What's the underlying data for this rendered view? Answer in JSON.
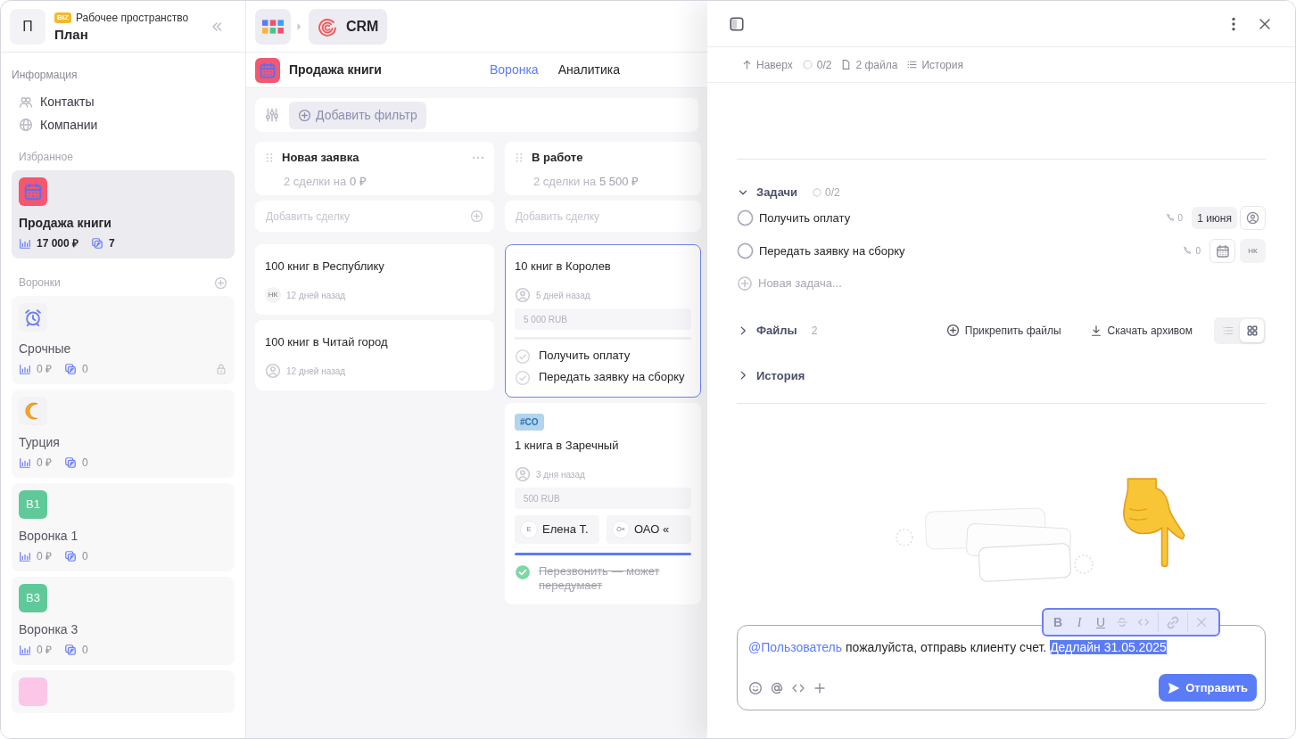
{
  "sidebar": {
    "workspace_avatar": "П",
    "badge": "BIZ",
    "workspace_label": "Рабочее пространство",
    "workspace_name": "План",
    "info_heading": "Информация",
    "info_items": [
      {
        "label": "Контакты"
      },
      {
        "label": "Компании"
      }
    ],
    "favorites_heading": "Избранное",
    "favorites": [
      {
        "kind": "calendar",
        "color": "#f4576f",
        "label": "Продажа книги",
        "amount": "17 000 ₽",
        "deals": "7",
        "selected": true,
        "locked": false
      }
    ],
    "funnels_heading": "Воронки",
    "funnels": [
      {
        "kind": "alarm",
        "label": "Срочные",
        "amount": "0 ₽",
        "deals": "0",
        "selected": false,
        "locked": true
      },
      {
        "kind": "moon",
        "label": "Турция",
        "amount": "0 ₽",
        "deals": "0",
        "selected": false,
        "locked": false
      },
      {
        "kind": "initials",
        "initials": "В1",
        "color": "#5fc99a",
        "label": "Воронка 1",
        "amount": "0 ₽",
        "deals": "0",
        "selected": false,
        "locked": false
      },
      {
        "kind": "initials",
        "initials": "В3",
        "color": "#5fc99a",
        "label": "Воронка 3",
        "amount": "0 ₽",
        "deals": "0",
        "selected": false,
        "locked": false
      },
      {
        "kind": "initials",
        "color": "#fcc6e8",
        "selected": false
      }
    ]
  },
  "breadcrumb": {
    "app": "CRM"
  },
  "page": {
    "title": "Продажа книги",
    "tabs": [
      {
        "label": "Воронка",
        "selected": true
      },
      {
        "label": "Аналитика",
        "selected": false
      }
    ]
  },
  "filter": {
    "button": "Добавить фильтр"
  },
  "columns": [
    {
      "title": "Новая заявка",
      "summary": "2 сделки на **0 ₽**",
      "add_placeholder": "Добавить сделку",
      "cards": [
        {
          "title": "100 книг в Республику",
          "selected": false,
          "avatar": "НК",
          "time": "12 дней назад"
        },
        {
          "title": "100 книг в Читай город",
          "selected": false,
          "time": "12 дней назад"
        }
      ]
    },
    {
      "title": "В работе",
      "summary": "2 сделки на **5 500 ₽**",
      "add_placeholder": "Добавить сделку",
      "cards": [
        {
          "title": "10 книг в Королев",
          "selected": true,
          "time": "5 дней назад",
          "amount": "5 000 RUB",
          "tasks": [
            {
              "label": "Получить оплату",
              "done": false
            },
            {
              "label": "Передать заявку на сборку",
              "done": false
            }
          ]
        },
        {
          "tag": "#CO",
          "title": "1 книга в Заречный",
          "selected": false,
          "time": "3 дня назад",
          "amount": "500 RUB",
          "contacts": [
            {
              "initial": "Е",
              "name": "Елена Т."
            },
            {
              "initial": "О«",
              "name": "ОАО «"
            }
          ],
          "tasks": [
            {
              "label": "Перезвонить — может передумает",
              "done": true
            }
          ]
        }
      ]
    }
  ],
  "detail": {
    "nav": [
      {
        "label": "Наверх"
      },
      {
        "label": "0/2"
      },
      {
        "label": "2 файла"
      },
      {
        "label": "История"
      }
    ],
    "tasks_section": {
      "title": "Задачи",
      "progress": "0/2",
      "expanded": true,
      "items": [
        {
          "label": "Получить оплату",
          "done": false,
          "calls": "0",
          "date": "1 июня"
        },
        {
          "label": "Передать заявку на сборку",
          "done": false,
          "calls": "0",
          "assignee": "НК"
        }
      ],
      "new_placeholder": "Новая задача..."
    },
    "files_section": {
      "title": "Файлы",
      "count": "2",
      "expanded": false,
      "attach": "Прикрепить файлы",
      "download": "Скачать архивом",
      "views": [
        {
          "kind": "list",
          "selected": false
        },
        {
          "kind": "grid",
          "selected": true
        }
      ]
    },
    "history_section": {
      "title": "История",
      "expanded": false
    },
    "comment": {
      "mention": "@Пользователь",
      "text": "пожалуйста, отправь клиенту счет.",
      "selected_text": "Дедлайн 31.05.2025",
      "format_buttons": [
        "B",
        "I",
        "U"
      ],
      "send": "Отправить"
    }
  }
}
